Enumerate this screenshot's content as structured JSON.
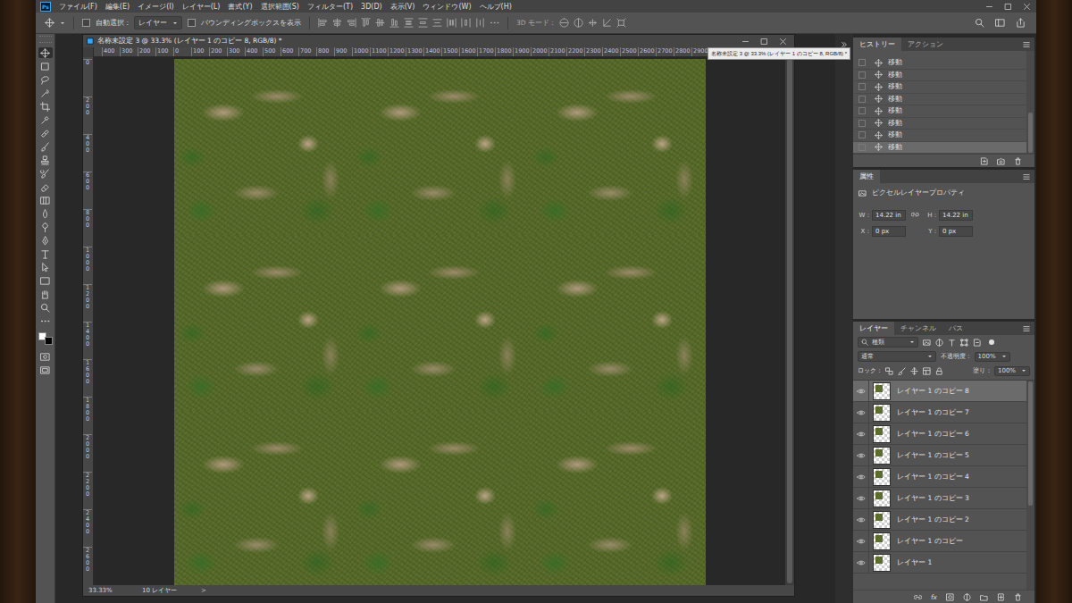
{
  "menubar": {
    "logo": "Ps",
    "menus": [
      "ファイル(F)",
      "編集(E)",
      "イメージ(I)",
      "レイヤー(L)",
      "書式(Y)",
      "選択範囲(S)",
      "フィルター(T)",
      "3D(D)",
      "表示(V)",
      "ウィンドウ(W)",
      "ヘルプ(H)"
    ]
  },
  "options_bar": {
    "auto_select": {
      "label": "自動選択 :",
      "checked": false
    },
    "target": "レイヤー",
    "bounding_box": {
      "label": "バウンディングボックスを表示",
      "checked": false
    },
    "mode_3d": "3D モード :"
  },
  "tools": [
    {
      "selected": true
    },
    {
      "selected": false
    },
    {
      "selected": false
    },
    {
      "selected": false
    },
    {
      "selected": false
    },
    {
      "selected": false
    },
    {
      "selected": false
    },
    {
      "selected": false
    },
    {
      "selected": false
    },
    {
      "selected": false
    },
    {
      "selected": false
    },
    {
      "selected": false
    },
    {
      "selected": false
    },
    {
      "selected": false
    },
    {
      "selected": false
    },
    {
      "selected": false
    },
    {
      "selected": false
    },
    {
      "selected": false
    },
    {
      "selected": false
    },
    {
      "selected": false
    },
    {
      "selected": false
    }
  ],
  "colors": {
    "foreground": "#ffffff",
    "background": "#000000"
  },
  "document": {
    "title": "名称未設定 3 @ 33.3% (レイヤー 1 のコピー 8, RGB/8) *",
    "tooltip": "名称未設定 3 @ 33.3% (レイヤー 1 のコピー 8, RGB/8) *",
    "ruler_h": [
      "400",
      "300",
      "200",
      "100",
      "0",
      "100",
      "200",
      "300",
      "400",
      "500",
      "600",
      "700",
      "800",
      "900",
      "1000",
      "1100",
      "1200",
      "1300",
      "1400",
      "1500",
      "1600",
      "1700",
      "1800",
      "1900",
      "2000",
      "2100",
      "2200",
      "2300",
      "2400",
      "2500",
      "2600",
      "2700",
      "2800",
      "2900"
    ],
    "ruler_v": [
      "0",
      "200",
      "400",
      "600",
      "800",
      "1000",
      "1200",
      "1400",
      "1600",
      "1800",
      "2000",
      "2200",
      "2400",
      "2600"
    ],
    "zoom": "33.33%",
    "layer_count": "10 レイヤー",
    "status_arrow": ">"
  },
  "history": {
    "tabs": [
      {
        "label": "ヒストリー",
        "selected": true
      },
      {
        "label": "アクション",
        "selected": false
      }
    ],
    "items": [
      {
        "label": "移動",
        "selected": false
      },
      {
        "label": "移動",
        "selected": false
      },
      {
        "label": "移動",
        "selected": false
      },
      {
        "label": "移動",
        "selected": false
      },
      {
        "label": "移動",
        "selected": false
      },
      {
        "label": "移動",
        "selected": false
      },
      {
        "label": "移動",
        "selected": false
      },
      {
        "label": "移動",
        "selected": true
      }
    ]
  },
  "properties": {
    "tab": "属性",
    "kind": "ピクセルレイヤープロパティ",
    "size": [
      {
        "label": "W :",
        "value": "14.22 in"
      },
      {
        "label": "H :",
        "value": "14.22 in"
      }
    ],
    "position": [
      {
        "label": "X :",
        "value": "0 px"
      },
      {
        "label": "Y :",
        "value": "0 px"
      }
    ]
  },
  "layers": {
    "tabs": [
      {
        "label": "レイヤー",
        "selected": true
      },
      {
        "label": "チャンネル",
        "selected": false
      },
      {
        "label": "パス",
        "selected": false
      }
    ],
    "filter": "種類",
    "blend_mode": "通常",
    "opacity_label": "不透明度 :",
    "opacity": "100%",
    "lock_label": "ロック :",
    "fill_label": "塗り :",
    "fill": "100%",
    "items": [
      {
        "name": "レイヤー 1 のコピー 8",
        "visible": true,
        "selected": true
      },
      {
        "name": "レイヤー 1 のコピー 7",
        "visible": true,
        "selected": false
      },
      {
        "name": "レイヤー 1 のコピー 6",
        "visible": true,
        "selected": false
      },
      {
        "name": "レイヤー 1 のコピー 5",
        "visible": true,
        "selected": false
      },
      {
        "name": "レイヤー 1 のコピー 4",
        "visible": true,
        "selected": false
      },
      {
        "name": "レイヤー 1 のコピー 3",
        "visible": true,
        "selected": false
      },
      {
        "name": "レイヤー 1 のコピー 2",
        "visible": true,
        "selected": false
      },
      {
        "name": "レイヤー 1 のコピー",
        "visible": true,
        "selected": false
      },
      {
        "name": "レイヤー 1",
        "visible": true,
        "selected": false
      }
    ],
    "footer_fx": "fx"
  }
}
